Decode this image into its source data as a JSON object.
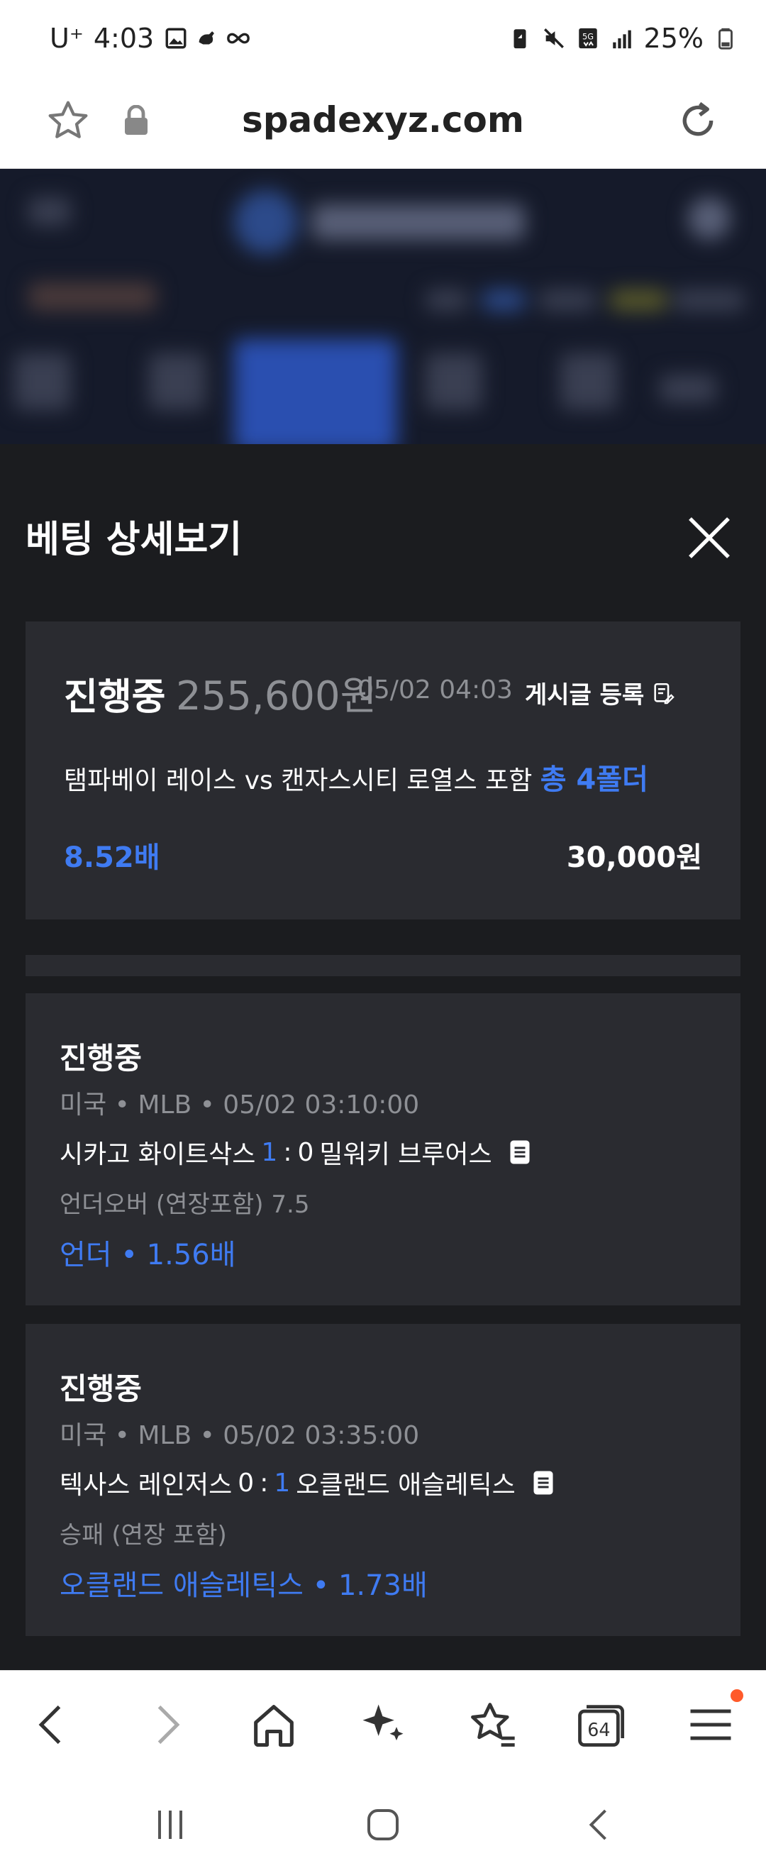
{
  "status_bar": {
    "carrier": "U⁺",
    "time": "4:03",
    "battery": "25%"
  },
  "browser": {
    "url": "spadexyz.com"
  },
  "modal": {
    "title": "베팅 상세보기",
    "summary": {
      "status": "진행중",
      "amount": "255,600원",
      "datetime": "05/02 04:03",
      "post_label": "게시글 등록",
      "match": "탬파베이 레이스 vs 캔자스시티 로열스 포함",
      "folder_count": "총 4폴더",
      "odds": "8.52배",
      "stake": "30,000원"
    },
    "bets": [
      {
        "status": "진행중",
        "meta": "미국 • MLB • 05/02 03:10:00",
        "home_team": "시카고 화이트삭스",
        "home_score": "1",
        "separator": ":",
        "away_score": "0",
        "away_team": "밀워키 브루어스",
        "market": "언더오버 (연장포함) 7.5",
        "pick": "언더 • 1.56배"
      },
      {
        "status": "진행중",
        "meta": "미국 • MLB • 05/02 03:35:00",
        "home_team": "텍사스 레인저스",
        "home_score": "0",
        "separator": ":",
        "away_score": "1",
        "away_team": "오클랜드 애슬레틱스",
        "market": "승패 (연장 포함)",
        "pick": "오클랜드 애슬레틱스 • 1.73배"
      }
    ]
  },
  "toolbar": {
    "tabs_count": "64"
  },
  "colors": {
    "accent": "#3f7bf2",
    "card_bg": "#2a2b30",
    "modal_bg": "#1b1c1f",
    "muted_text": "#8e9095"
  }
}
